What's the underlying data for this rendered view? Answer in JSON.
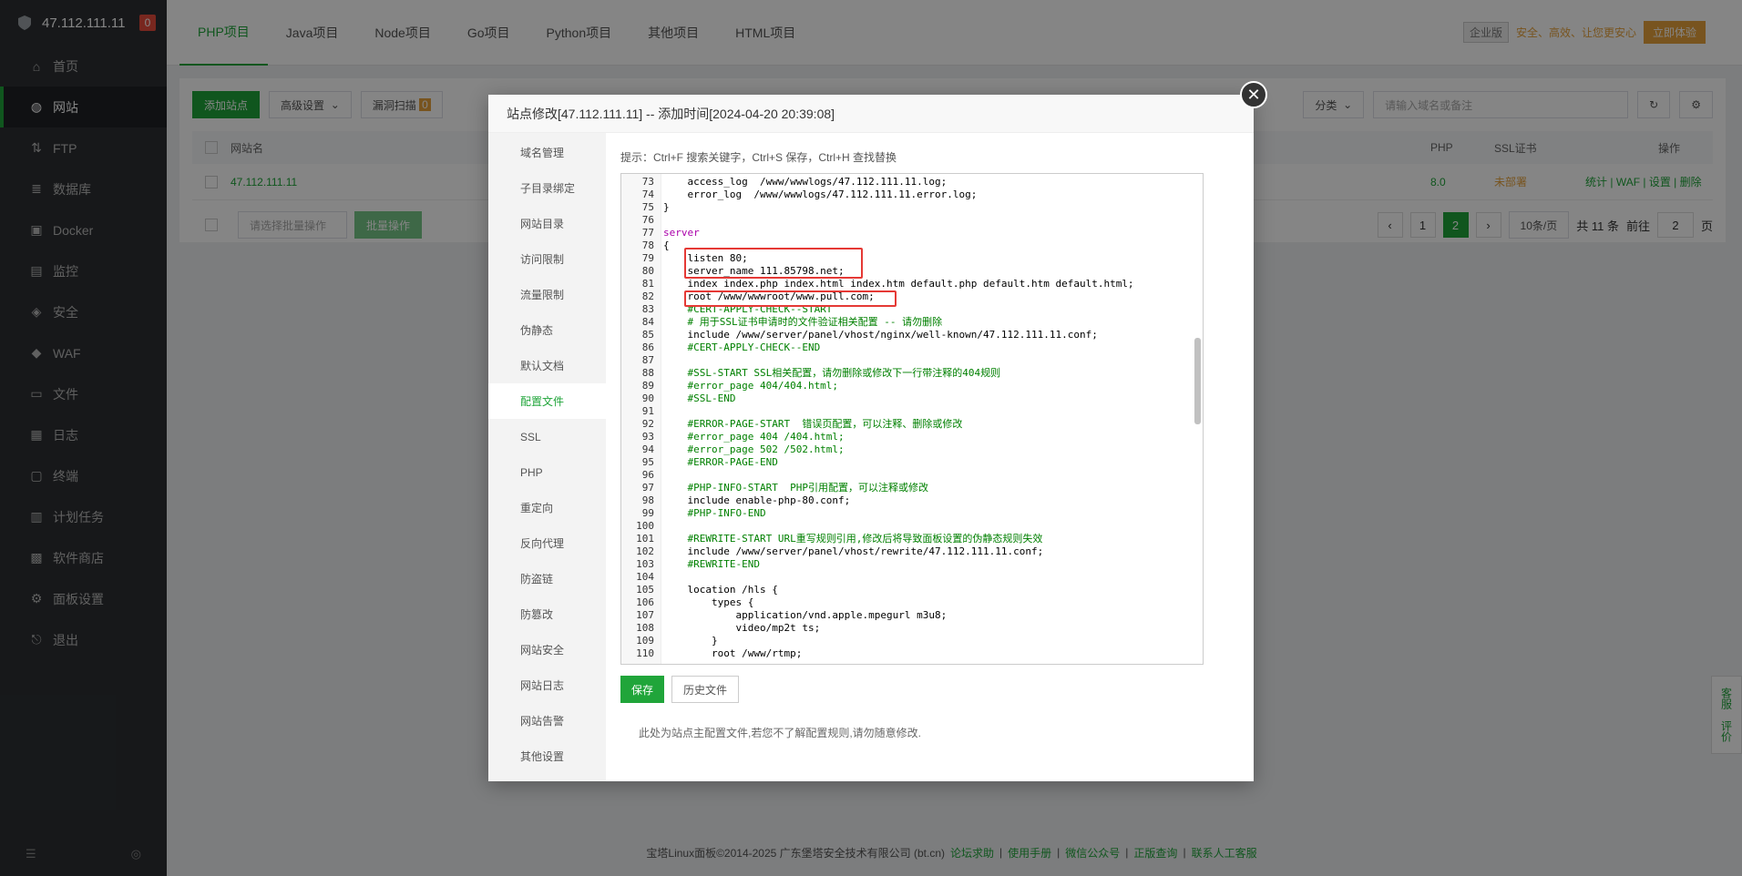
{
  "sidebar": {
    "ip": "47.112.111.11",
    "badge": "0",
    "items": [
      {
        "label": "首页",
        "icon": "home-icon"
      },
      {
        "label": "网站",
        "icon": "globe-icon"
      },
      {
        "label": "FTP",
        "icon": "ftp-icon"
      },
      {
        "label": "数据库",
        "icon": "database-icon"
      },
      {
        "label": "Docker",
        "icon": "docker-icon"
      },
      {
        "label": "监控",
        "icon": "monitor-icon"
      },
      {
        "label": "安全",
        "icon": "shield-icon"
      },
      {
        "label": "WAF",
        "icon": "waf-icon"
      },
      {
        "label": "文件",
        "icon": "folder-icon"
      },
      {
        "label": "日志",
        "icon": "log-icon"
      },
      {
        "label": "终端",
        "icon": "terminal-icon"
      },
      {
        "label": "计划任务",
        "icon": "task-icon"
      },
      {
        "label": "软件商店",
        "icon": "store-icon"
      },
      {
        "label": "面板设置",
        "icon": "settings-icon"
      },
      {
        "label": "退出",
        "icon": "logout-icon"
      }
    ]
  },
  "tabs": [
    "PHP项目",
    "Java项目",
    "Node项目",
    "Go项目",
    "Python项目",
    "其他项目",
    "HTML项目"
  ],
  "topright": {
    "enterprise": "企业版",
    "security": "安全、高效、让您更安心",
    "try": "立即体验"
  },
  "toolbar": {
    "add_site": "添加站点",
    "advanced": "高级设置",
    "vuln_scan": "漏洞扫描",
    "vuln_count": "0",
    "category": "分类",
    "search_placeholder": "请输入域名或备注"
  },
  "table": {
    "headers": {
      "name": "网站名",
      "php": "PHP",
      "ssl": "SSL证书",
      "ops": "操作"
    },
    "row": {
      "name": "47.112.111.11",
      "php": "8.0",
      "ssl": "未部署",
      "ops": [
        "统计",
        "WAF",
        "设置",
        "删除"
      ]
    }
  },
  "bulk": {
    "select_placeholder": "请选择批量操作",
    "bulk_btn": "批量操作"
  },
  "pager": {
    "page1": "1",
    "page2": "2",
    "per_page": "10条/页",
    "total": "共 11 条",
    "goto": "前往",
    "goto_value": "2",
    "page_unit": "页"
  },
  "footer": {
    "copyright": "宝塔Linux面板©2014-2025 广东堡塔安全技术有限公司 (bt.cn)",
    "links": [
      "论坛求助",
      "使用手册",
      "微信公众号",
      "正版查询",
      "联系人工客服"
    ]
  },
  "side_tools": [
    "客服",
    "评价"
  ],
  "modal": {
    "title": "站点修改[47.112.111.11] -- 添加时间[2024-04-20 20:39:08]",
    "nav": [
      "域名管理",
      "子目录绑定",
      "网站目录",
      "访问限制",
      "流量限制",
      "伪静态",
      "默认文档",
      "配置文件",
      "SSL",
      "PHP",
      "重定向",
      "反向代理",
      "防盗链",
      "防篡改",
      "网站安全",
      "网站日志",
      "网站告警",
      "其他设置"
    ],
    "active_nav": "配置文件",
    "hint": "提示：Ctrl+F 搜索关键字，Ctrl+S 保存，Ctrl+H 查找替换",
    "save": "保存",
    "history": "历史文件",
    "note": "此处为站点主配置文件,若您不了解配置规则,请勿随意修改."
  },
  "code_lines": [
    {
      "n": "73",
      "t": "    access_log  /www/wwwlogs/47.112.111.11.log;"
    },
    {
      "n": "74",
      "t": "    error_log  /www/wwwlogs/47.112.111.11.error.log;"
    },
    {
      "n": "75",
      "t": "}"
    },
    {
      "n": "76",
      "t": ""
    },
    {
      "n": "77",
      "t": "server"
    },
    {
      "n": "78",
      "t": "{"
    },
    {
      "n": "79",
      "t": "    listen 80;"
    },
    {
      "n": "80",
      "t": "    server_name 111.85798.net;"
    },
    {
      "n": "81",
      "t": "    index index.php index.html index.htm default.php default.htm default.html;"
    },
    {
      "n": "82",
      "t": "    root /www/wwwroot/www.pull.com;"
    },
    {
      "n": "83",
      "t": "    #CERT-APPLY-CHECK--START"
    },
    {
      "n": "84",
      "t": "    # 用于SSL证书申请时的文件验证相关配置 -- 请勿删除"
    },
    {
      "n": "85",
      "t": "    include /www/server/panel/vhost/nginx/well-known/47.112.111.11.conf;"
    },
    {
      "n": "86",
      "t": "    #CERT-APPLY-CHECK--END"
    },
    {
      "n": "87",
      "t": ""
    },
    {
      "n": "88",
      "t": "    #SSL-START SSL相关配置，请勿删除或修改下一行带注释的404规则"
    },
    {
      "n": "89",
      "t": "    #error_page 404/404.html;"
    },
    {
      "n": "90",
      "t": "    #SSL-END"
    },
    {
      "n": "91",
      "t": ""
    },
    {
      "n": "92",
      "t": "    #ERROR-PAGE-START  错误页配置，可以注释、删除或修改"
    },
    {
      "n": "93",
      "t": "    #error_page 404 /404.html;"
    },
    {
      "n": "94",
      "t": "    #error_page 502 /502.html;"
    },
    {
      "n": "95",
      "t": "    #ERROR-PAGE-END"
    },
    {
      "n": "96",
      "t": ""
    },
    {
      "n": "97",
      "t": "    #PHP-INFO-START  PHP引用配置，可以注释或修改"
    },
    {
      "n": "98",
      "t": "    include enable-php-80.conf;"
    },
    {
      "n": "99",
      "t": "    #PHP-INFO-END"
    },
    {
      "n": "100",
      "t": ""
    },
    {
      "n": "101",
      "t": "    #REWRITE-START URL重写规则引用,修改后将导致面板设置的伪静态规则失效"
    },
    {
      "n": "102",
      "t": "    include /www/server/panel/vhost/rewrite/47.112.111.11.conf;"
    },
    {
      "n": "103",
      "t": "    #REWRITE-END"
    },
    {
      "n": "104",
      "t": ""
    },
    {
      "n": "105",
      "t": "    location /hls {"
    },
    {
      "n": "106",
      "t": "        types {"
    },
    {
      "n": "107",
      "t": "            application/vnd.apple.mpegurl m3u8;"
    },
    {
      "n": "108",
      "t": "            video/mp2t ts;"
    },
    {
      "n": "109",
      "t": "        }"
    },
    {
      "n": "110",
      "t": "        root /www/rtmp;"
    }
  ],
  "colors": {
    "accent": "#20a53a",
    "comment": "#008000",
    "keyword": "#aa00aa",
    "highlight_box": "#e53935"
  }
}
